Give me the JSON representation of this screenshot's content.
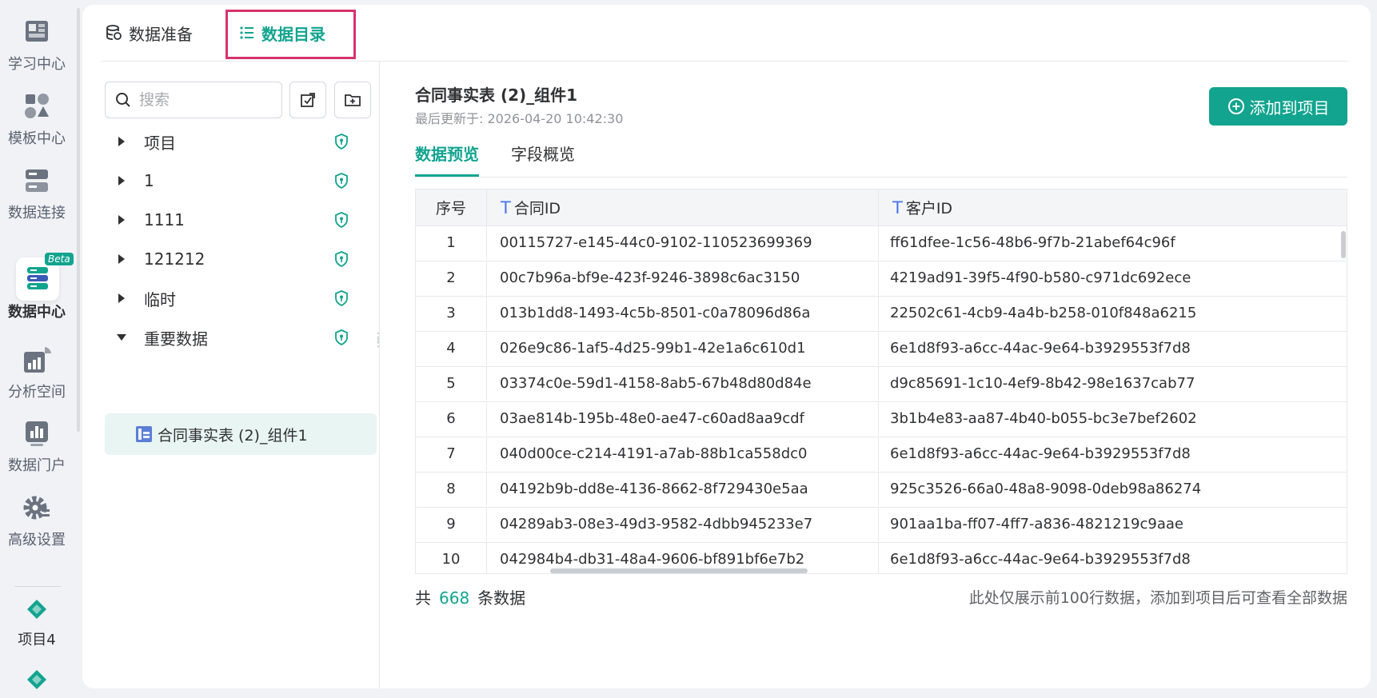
{
  "rail": {
    "items": [
      {
        "label": "学习中心",
        "icon": "book-grid-icon"
      },
      {
        "label": "模板中心",
        "icon": "template-shapes-icon"
      },
      {
        "label": "数据连接",
        "icon": "server-icon"
      },
      {
        "label": "数据中心",
        "icon": "data-stack-icon",
        "badge": "Beta"
      },
      {
        "label": "分析空间",
        "icon": "chart-pie-icon"
      },
      {
        "label": "数据门户",
        "icon": "bar-board-icon"
      },
      {
        "label": "高级设置",
        "icon": "gear-icon"
      },
      {
        "label": "项目4",
        "icon": "project-diamond-icon"
      }
    ]
  },
  "topnav": {
    "prep_label": "数据准备",
    "catalog_label": "数据目录"
  },
  "tree": {
    "search_placeholder": "搜索",
    "nodes": [
      {
        "label": "项目",
        "expanded": false
      },
      {
        "label": "1",
        "expanded": false
      },
      {
        "label": "1111",
        "expanded": false
      },
      {
        "label": "121212",
        "expanded": false
      },
      {
        "label": "临时",
        "expanded": false
      },
      {
        "label": "重要数据",
        "expanded": true
      }
    ],
    "selected_leaf": "合同事实表 (2)_组件1"
  },
  "detail": {
    "title": "合同事实表 (2)_组件1",
    "updated": "最后更新于: 2026-04-20 10:42:30",
    "add_button": "添加到项目",
    "tabs": [
      "数据预览",
      "字段概览"
    ],
    "columns": [
      "序号",
      "合同ID",
      "客户ID"
    ],
    "rows": [
      [
        "1",
        "00115727-e145-44c0-9102-110523699369",
        "ff61dfee-1c56-48b6-9f7b-21abef64c96f"
      ],
      [
        "2",
        "00c7b96a-bf9e-423f-9246-3898c6ac3150",
        "4219ad91-39f5-4f90-b580-c971dc692ece"
      ],
      [
        "3",
        "013b1dd8-1493-4c5b-8501-c0a78096d86a",
        "22502c61-4cb9-4a4b-b258-010f848a6215"
      ],
      [
        "4",
        "026e9c86-1af5-4d25-99b1-42e1a6c610d1",
        "6e1d8f93-a6cc-44ac-9e64-b3929553f7d8"
      ],
      [
        "5",
        "03374c0e-59d1-4158-8ab5-67b48d80d84e",
        "d9c85691-1c10-4ef9-8b42-98e1637cab77"
      ],
      [
        "6",
        "03ae814b-195b-48e0-ae47-c60ad8aa9cdf",
        "3b1b4e83-aa87-4b40-b055-bc3e7bef2602"
      ],
      [
        "7",
        "040d00ce-c214-4191-a7ab-88b1ca558dc0",
        "6e1d8f93-a6cc-44ac-9e64-b3929553f7d8"
      ],
      [
        "8",
        "04192b9b-dd8e-4136-8662-8f729430e5aa",
        "925c3526-66a0-48a8-9098-0deb98a86274"
      ],
      [
        "9",
        "04289ab3-08e3-49d3-9582-4dbb945233e7",
        "901aa1ba-ff07-4ff7-a836-4821219c9aae"
      ],
      [
        "10",
        "042984b4-db31-48a4-9606-bf891bf6e7b2",
        "6e1d8f93-a6cc-44ac-9e64-b3929553f7d8"
      ]
    ],
    "footer_prefix": "共",
    "footer_count": "668",
    "footer_suffix": "条数据",
    "footer_note": "此处仅展示前100行数据，添加到项目后可查看全部数据"
  },
  "colors": {
    "accent": "#12a48f",
    "highlight_box": "#d6336c",
    "type_icon": "#4a74e8"
  }
}
